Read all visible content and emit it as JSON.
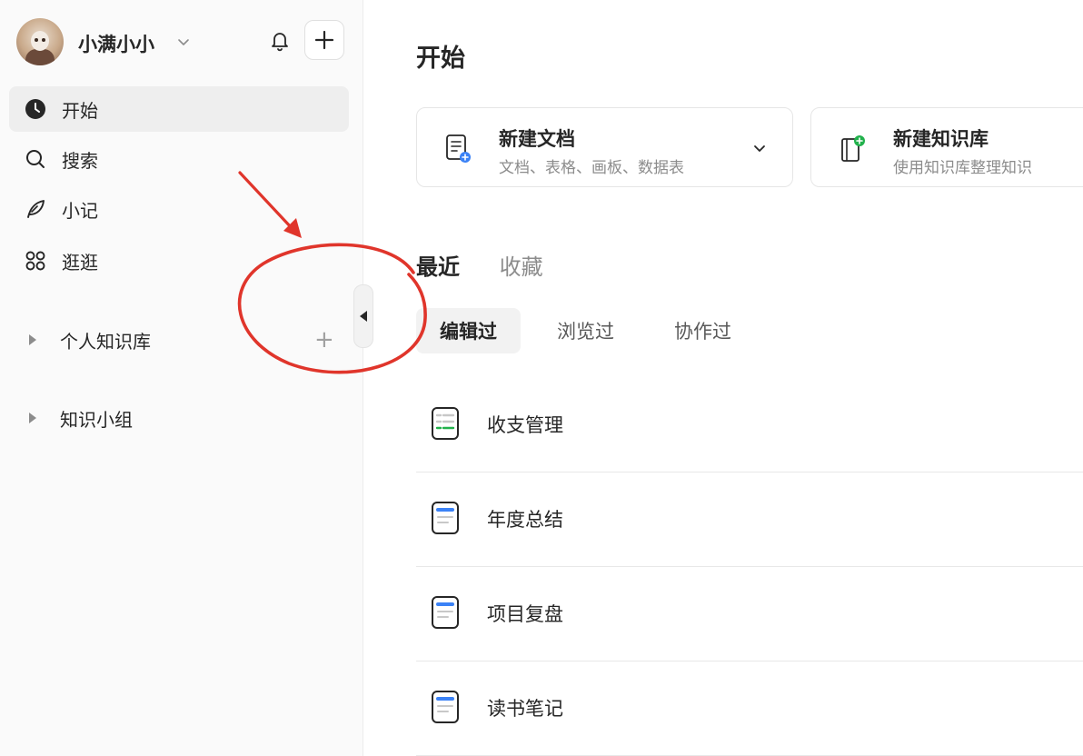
{
  "sidebar": {
    "username": "小满小小",
    "nav": [
      {
        "label": "开始",
        "icon": "clock-icon",
        "active": true
      },
      {
        "label": "搜索",
        "icon": "search-icon",
        "active": false
      },
      {
        "label": "小记",
        "icon": "feather-icon",
        "active": false
      },
      {
        "label": "逛逛",
        "icon": "grid-icon",
        "active": false
      }
    ],
    "groups": [
      {
        "label": "个人知识库"
      },
      {
        "label": "知识小组"
      }
    ],
    "group_add_symbol": "+"
  },
  "main": {
    "title": "开始",
    "cards": [
      {
        "title": "新建文档",
        "subtitle": "文档、表格、画板、数据表"
      },
      {
        "title": "新建知识库",
        "subtitle": "使用知识库整理知识"
      }
    ],
    "tabs": [
      "最近",
      "收藏"
    ],
    "subtabs": [
      "编辑过",
      "浏览过",
      "协作过"
    ],
    "docs": [
      {
        "title": "收支管理",
        "icon": "sheet-doc-icon"
      },
      {
        "title": "年度总结",
        "icon": "text-doc-icon"
      },
      {
        "title": "项目复盘",
        "icon": "text-doc-icon"
      },
      {
        "title": "读书笔记",
        "icon": "text-doc-icon"
      }
    ]
  },
  "colors": {
    "annotation": "#e0352b",
    "accent_blue": "#3b82f6",
    "accent_green": "#22b14c"
  }
}
